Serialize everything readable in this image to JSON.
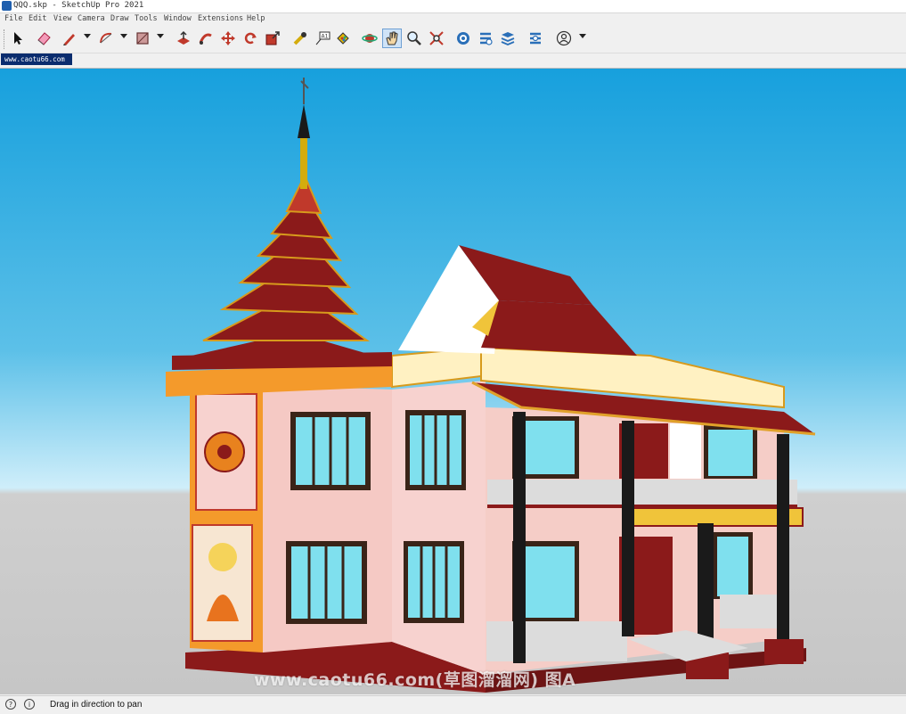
{
  "window": {
    "title": "QQQ.skp - SketchUp Pro 2021"
  },
  "menu": [
    "File",
    "Edit",
    "View",
    "Camera",
    "Draw",
    "Tools",
    "Window",
    "Extensions",
    "Help"
  ],
  "toolbar": {
    "tools": [
      "select",
      "eraser",
      "line",
      "arc",
      "rectangle",
      "push-pull",
      "follow-me",
      "move",
      "rotate",
      "scale",
      "tape-measure",
      "text",
      "paint-bucket",
      "orbit",
      "pan",
      "zoom",
      "zoom-extents",
      "add-location",
      "extension-warehouse",
      "3d-warehouse",
      "layout",
      "account"
    ],
    "active_tool": "pan"
  },
  "scene_tab": {
    "label": "www.caotu66.com"
  },
  "viewport": {
    "watermark": "www.caotu66.com(草图溜溜网) 图A"
  },
  "status": {
    "message": "Drag in direction to pan"
  }
}
